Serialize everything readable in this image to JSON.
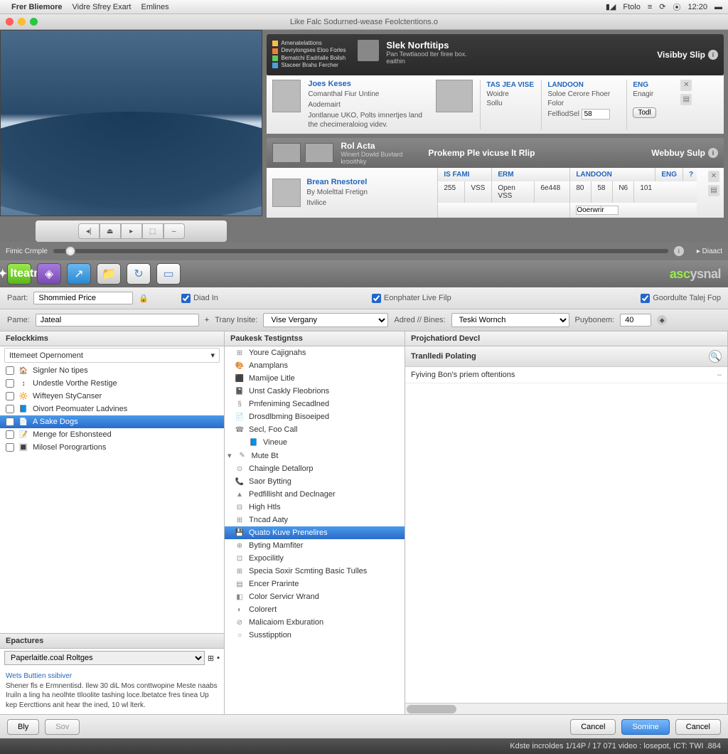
{
  "menubar": {
    "items": [
      "Frer Bliemore",
      "Vidre Sfrey Exart",
      "Emlines"
    ],
    "right": {
      "folio": "Ftolo",
      "time": "12:20"
    }
  },
  "titlebar": {
    "text": "Like Falc Sodurned-wease Feolctentions.o"
  },
  "preview": {
    "label": "Fimic Crmple",
    "info_btn": "i",
    "diact": "Diaact"
  },
  "play": {
    "b1": "◂|",
    "b2": "⏏",
    "b3": "▸",
    "b4": "⬚",
    "b5": "–"
  },
  "card1": {
    "legend": [
      {
        "color": "#f5c04a",
        "txt": "Amenatelattions"
      },
      {
        "color": "#f08030",
        "txt": "Devrylongses Eloo Forles"
      },
      {
        "color": "#60c860",
        "txt": "Bematchi Eadrlalle Boilsh"
      },
      {
        "color": "#4aa0e0",
        "txt": "Staceer Brahs Fercher"
      }
    ],
    "title": "Slek Norftitips",
    "sub": "Pan Tewtlaood lter firee box.",
    "sub2": "eaithin",
    "link": "Visibby Slip",
    "row": {
      "name": "Joes Keses",
      "l1": "Comanthal Fiur Untine",
      "l2": "Aodemairt",
      "l3": "Jontlanue UKO, Polts imnertjes land the checimeraloiog videv.",
      "cols": [
        {
          "h": "TAS JEA VISE",
          "v": "Woidre",
          "v2": "Sollu"
        },
        {
          "h": "LANDOON",
          "v": "Soloe Cerore Fhoer",
          "v2": "Folor",
          "field_lbl": "FelfiodSel",
          "field_val": "58"
        },
        {
          "h": "ENG",
          "v": "Enagir",
          "v2": "",
          "btn": "Todl"
        }
      ]
    }
  },
  "card2": {
    "strip_title": "Rol Acta",
    "strip_sub": "Winert Dowld Buvtard",
    "strip_sub2": "krooithky",
    "mid_title": "Prokemp Ple vicuse lt Rlip",
    "link": "Webbuy Sulp",
    "row": {
      "name": "Brean Rnestorel",
      "l1": "By Molelttal Fretign",
      "l2": "Itvilice",
      "cols": [
        {
          "h": "IS FAMI",
          "c1": "255",
          "c2": "VSS"
        },
        {
          "h": "ERM",
          "c1": "Open VSS",
          "c2": "6e448"
        },
        {
          "h": "LANDOON",
          "c1": "80",
          "c2": "58",
          "c3": "N6",
          "extra": "Ooerwrir"
        },
        {
          "h": "ENG",
          "c1": "101"
        }
      ]
    }
  },
  "toolbar": {
    "btn_green": "lteatn",
    "brand_a": "asc",
    "brand_b": "ysnal"
  },
  "formbar": {
    "paart_lbl": "Paart:",
    "paart_val": "Shommied Price",
    "cb1": "Diad In",
    "cb2": "Eonphater Live Filp",
    "cb3": "Goordulte Talej Fop"
  },
  "formbar2": {
    "pame_lbl": "Pame:",
    "pame_val": "Jateal",
    "trany_lbl": "Trany Insite:",
    "trany_val": "Vise Vergany",
    "adred_lbl": "Adred // Bines:",
    "adred_val": "Teski Wornch",
    "puy_lbl": "Puybonem:",
    "puy_val": "40"
  },
  "pane_l": {
    "head": "Felockkims",
    "sel": "Ittemeet Opernoment",
    "items": [
      {
        "icon": "🏠",
        "txt": "Signler No tipes"
      },
      {
        "icon": "↕",
        "txt": "Undestle Vorthe Restige"
      },
      {
        "icon": "🔆",
        "txt": "Wifteyen StyCanser"
      },
      {
        "icon": "📘",
        "txt": "Oivort Peomuater Ladvines"
      },
      {
        "icon": "📄",
        "txt": "A Sake Dogs",
        "sel": true
      },
      {
        "icon": "📝",
        "txt": "Menge for Eshonsteed"
      },
      {
        "icon": "🔳",
        "txt": "Milosel Porogrartions"
      }
    ],
    "feat_head": "Epactures",
    "feat_sel": "Paperlaitle.coal Roltges",
    "desc_title": "Wets Buttien ssibiver",
    "desc_body": "Shener fls e Ermnentisd. Ilew 30 diL Mos conttwopine Meste naabs Iruiln a ling ha neolhte tIloolite tashing loce.lbetatce fres tinea Up kep Eercttions anit hear the ined, 10 wl lterk."
  },
  "pane_m": {
    "head": "Paukesk Testigntss",
    "items": [
      {
        "i": "⊞",
        "t": "Youre Cajignahs"
      },
      {
        "i": "🎨",
        "t": "Anamplans"
      },
      {
        "i": "⬛",
        "t": "Mamijoe Litle"
      },
      {
        "i": "📓",
        "t": "Unst Caskly Fleobrions"
      },
      {
        "i": "§",
        "t": "Pmfeniming Secadlned"
      },
      {
        "i": "📄",
        "t": "Drosdlbming Bisoeiped"
      },
      {
        "i": "☎",
        "t": "Secl, Foo Call"
      },
      {
        "i": "📘",
        "t": "Vineue",
        "indent": true
      },
      {
        "i": "✎",
        "t": "Mute Bt",
        "caret": true
      },
      {
        "i": "⊙",
        "t": "Chaingle Detallorp"
      },
      {
        "i": "📞",
        "t": "Saor Bytting"
      },
      {
        "i": "▲",
        "t": "Pedfillisht and Declnager"
      },
      {
        "i": "⊟",
        "t": "High Htls"
      },
      {
        "i": "⊞",
        "t": "Tncad Aaty"
      },
      {
        "i": "💾",
        "t": "Quato Kuve Prenelires",
        "sel": true
      },
      {
        "i": "⊕",
        "t": "Byting Mamfiter"
      },
      {
        "i": "⊡",
        "t": "Expocilitly"
      },
      {
        "i": "⊞",
        "t": "Specia Soxir Scmting Basic Tulles"
      },
      {
        "i": "▤",
        "t": "Encer Prarinte"
      },
      {
        "i": "◧",
        "t": "Color Servicr Wrand"
      },
      {
        "i": "◐",
        "t": "Colorert"
      },
      {
        "i": "⊘",
        "t": "Malicaiom Exburation"
      },
      {
        "i": "○",
        "t": "Susstipption"
      }
    ]
  },
  "pane_r": {
    "head": "Projchatiord Devcl",
    "sub": "Tranlledi Polating",
    "line": "Fyiving Bon's priem oftentions"
  },
  "btnbar": {
    "bly": "Bly",
    "sov": "Sov",
    "cancel1": "Cancel",
    "somine": "Somine",
    "cancel2": "Cancel"
  },
  "status": {
    "text": "Kdste incroldes 1/14P / 17 071 video : losepot, ICT: TWI .884"
  }
}
